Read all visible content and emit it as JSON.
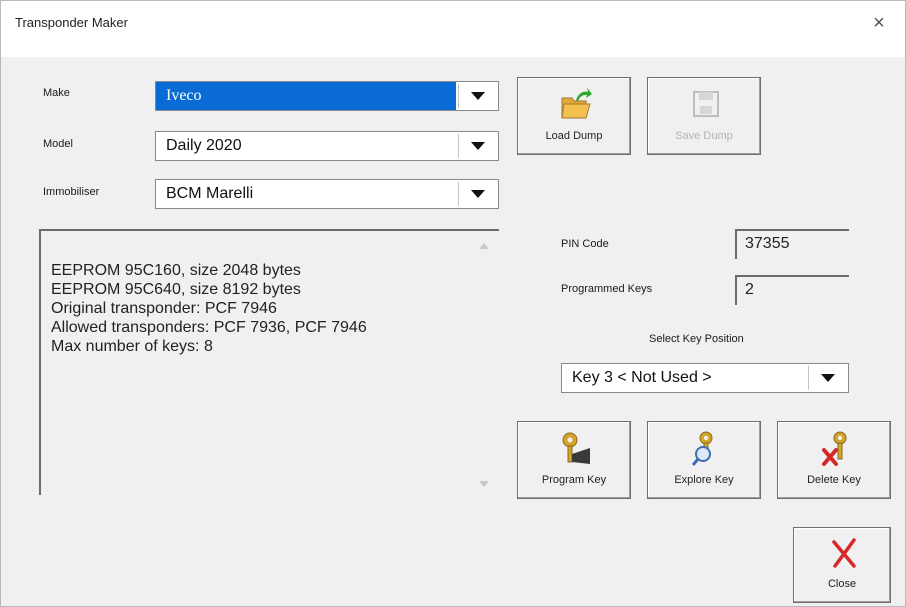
{
  "window": {
    "title": "Transponder Maker",
    "close_glyph": "×"
  },
  "form": {
    "make": {
      "label": "Make",
      "value": "Iveco"
    },
    "model": {
      "label": "Model",
      "value": "Daily 2020"
    },
    "immobiliser": {
      "label": "Immobiliser",
      "value": "BCM Marelli"
    }
  },
  "info": {
    "lines": [
      "EEPROM 95C160, size 2048 bytes",
      "EEPROM 95C640, size 8192 bytes",
      "Original transponder: PCF 7946",
      "Allowed transponders: PCF 7936, PCF 7946",
      "Max number of keys: 8"
    ]
  },
  "buttons": {
    "load_dump": "Load Dump",
    "save_dump": "Save Dump",
    "program_key": "Program Key",
    "explore_key": "Explore Key",
    "delete_key": "Delete Key",
    "close": "Close"
  },
  "pin": {
    "label": "PIN Code",
    "value": "37355"
  },
  "programmed_keys": {
    "label": "Programmed Keys",
    "value": "2"
  },
  "key_position": {
    "label": "Select Key Position",
    "value": "Key 3  < Not Used >"
  },
  "colors": {
    "selection": "#0a6bd6",
    "folder": "#f2c14e",
    "arrow": "#2aa82a",
    "delete": "#d62828"
  }
}
